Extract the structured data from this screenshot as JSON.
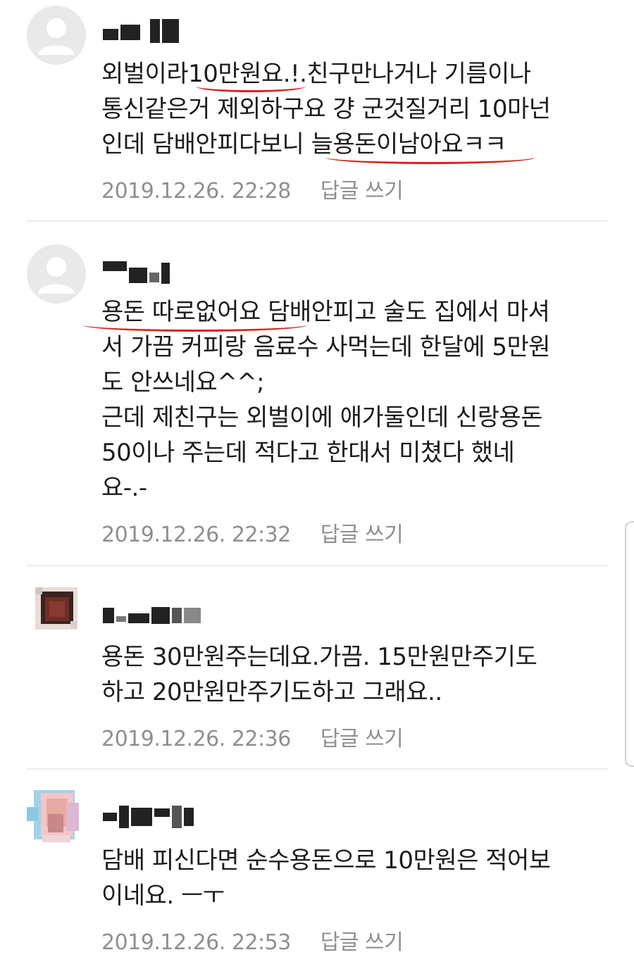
{
  "comments": [
    {
      "text": "외벌이라10만원요.!.친구만나거나 기름이나\n통신같은거 제외하구요 걍 군것질거리 10마넌\n인데 담배안피다보니 늘용돈이남아요ㅋㅋ",
      "date": "2019.12.26. 22:28",
      "reply_label": "답글 쓰기"
    },
    {
      "text": "용돈 따로없어요 담배안피고 술도 집에서 마셔\n서 가끔 커피랑 음료수 사먹는데 한달에 5만원\n도 안쓰네요^^;\n근데 제친구는 외벌이에 애가둘인데 신랑용돈\n50이나 주는데 적다고 한대서 미쳤다 했네\n요-.-",
      "date": "2019.12.26. 22:32",
      "reply_label": "답글 쓰기"
    },
    {
      "text": "용돈 30만원주는데요.가끔. 15만원만주기도\n하고 20만원만주기도하고 그래요..",
      "date": "2019.12.26. 22:36",
      "reply_label": "답글 쓰기"
    },
    {
      "text": "담배 피신다면 순수용돈으로 10만원은 적어보\n이네요. ㅡㅜ",
      "date": "2019.12.26. 22:53",
      "reply_label": "답글 쓰기"
    }
  ],
  "colors": {
    "text": "#1c1c1c",
    "meta": "#8f8f8f",
    "divider": "#ececec",
    "highlight_underline": "#d7231f",
    "default_avatar": "#e9e9e9"
  }
}
